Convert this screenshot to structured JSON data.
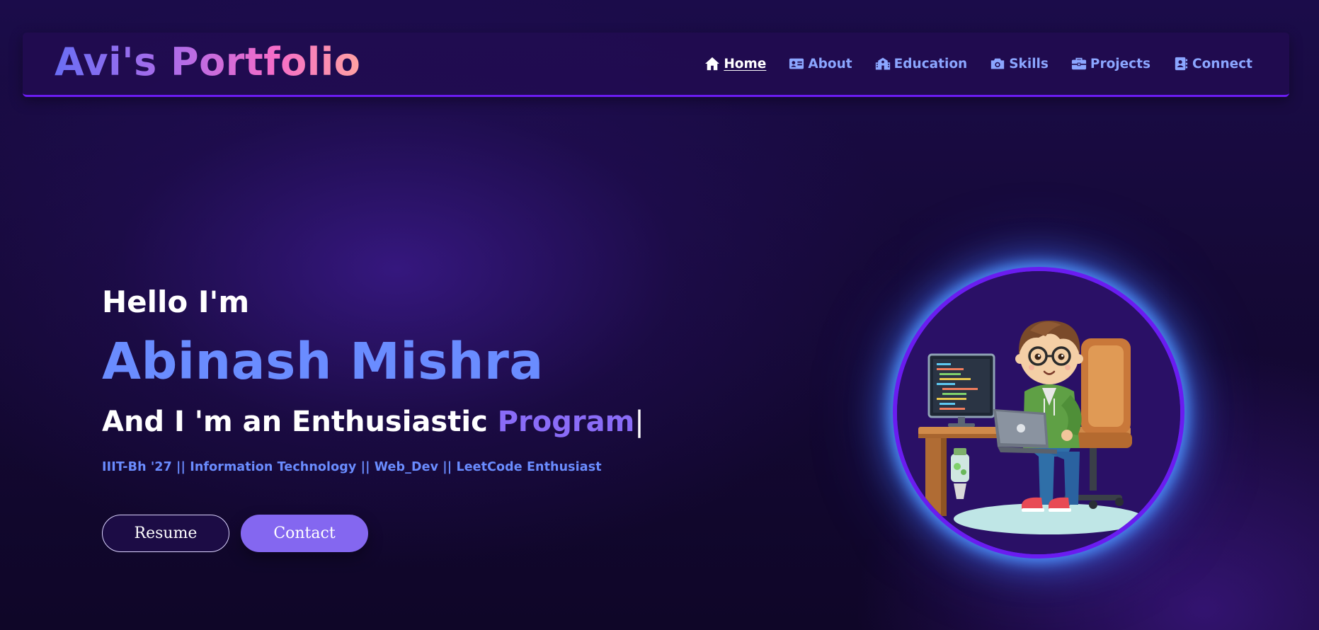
{
  "brand": {
    "title": "Avi's Portfolio",
    "gradient": [
      "#6a6ef5",
      "#b06ce8",
      "#f56cc8",
      "#ffa2a2"
    ]
  },
  "nav": {
    "items": [
      {
        "label": "Home",
        "icon": "home-icon",
        "active": true
      },
      {
        "label": "About",
        "icon": "id-card-icon",
        "active": false
      },
      {
        "label": "Education",
        "icon": "school-icon",
        "active": false
      },
      {
        "label": "Skills",
        "icon": "camera-icon",
        "active": false
      },
      {
        "label": "Projects",
        "icon": "briefcase-icon",
        "active": false
      },
      {
        "label": "Connect",
        "icon": "contact-book-icon",
        "active": false
      }
    ]
  },
  "hero": {
    "greeting": "Hello I'm",
    "name": "Abinash Mishra",
    "tagline_prefix": "And I 'm an Enthusiastic",
    "typed_text": "Program",
    "cursor": "|",
    "subline": "IIIT-Bh '27 || Information Technology || Web_Dev || LeetCode Enthusiast",
    "resume_label": "Resume",
    "contact_label": "Contact"
  },
  "avatar": {
    "icon": "programmer-avatar-illustration"
  },
  "colors": {
    "accent_blue": "#6a8cff",
    "accent_purple": "#8a6cf7",
    "border_purple": "#6a1cf0",
    "glow_blue": "#5096ff"
  }
}
